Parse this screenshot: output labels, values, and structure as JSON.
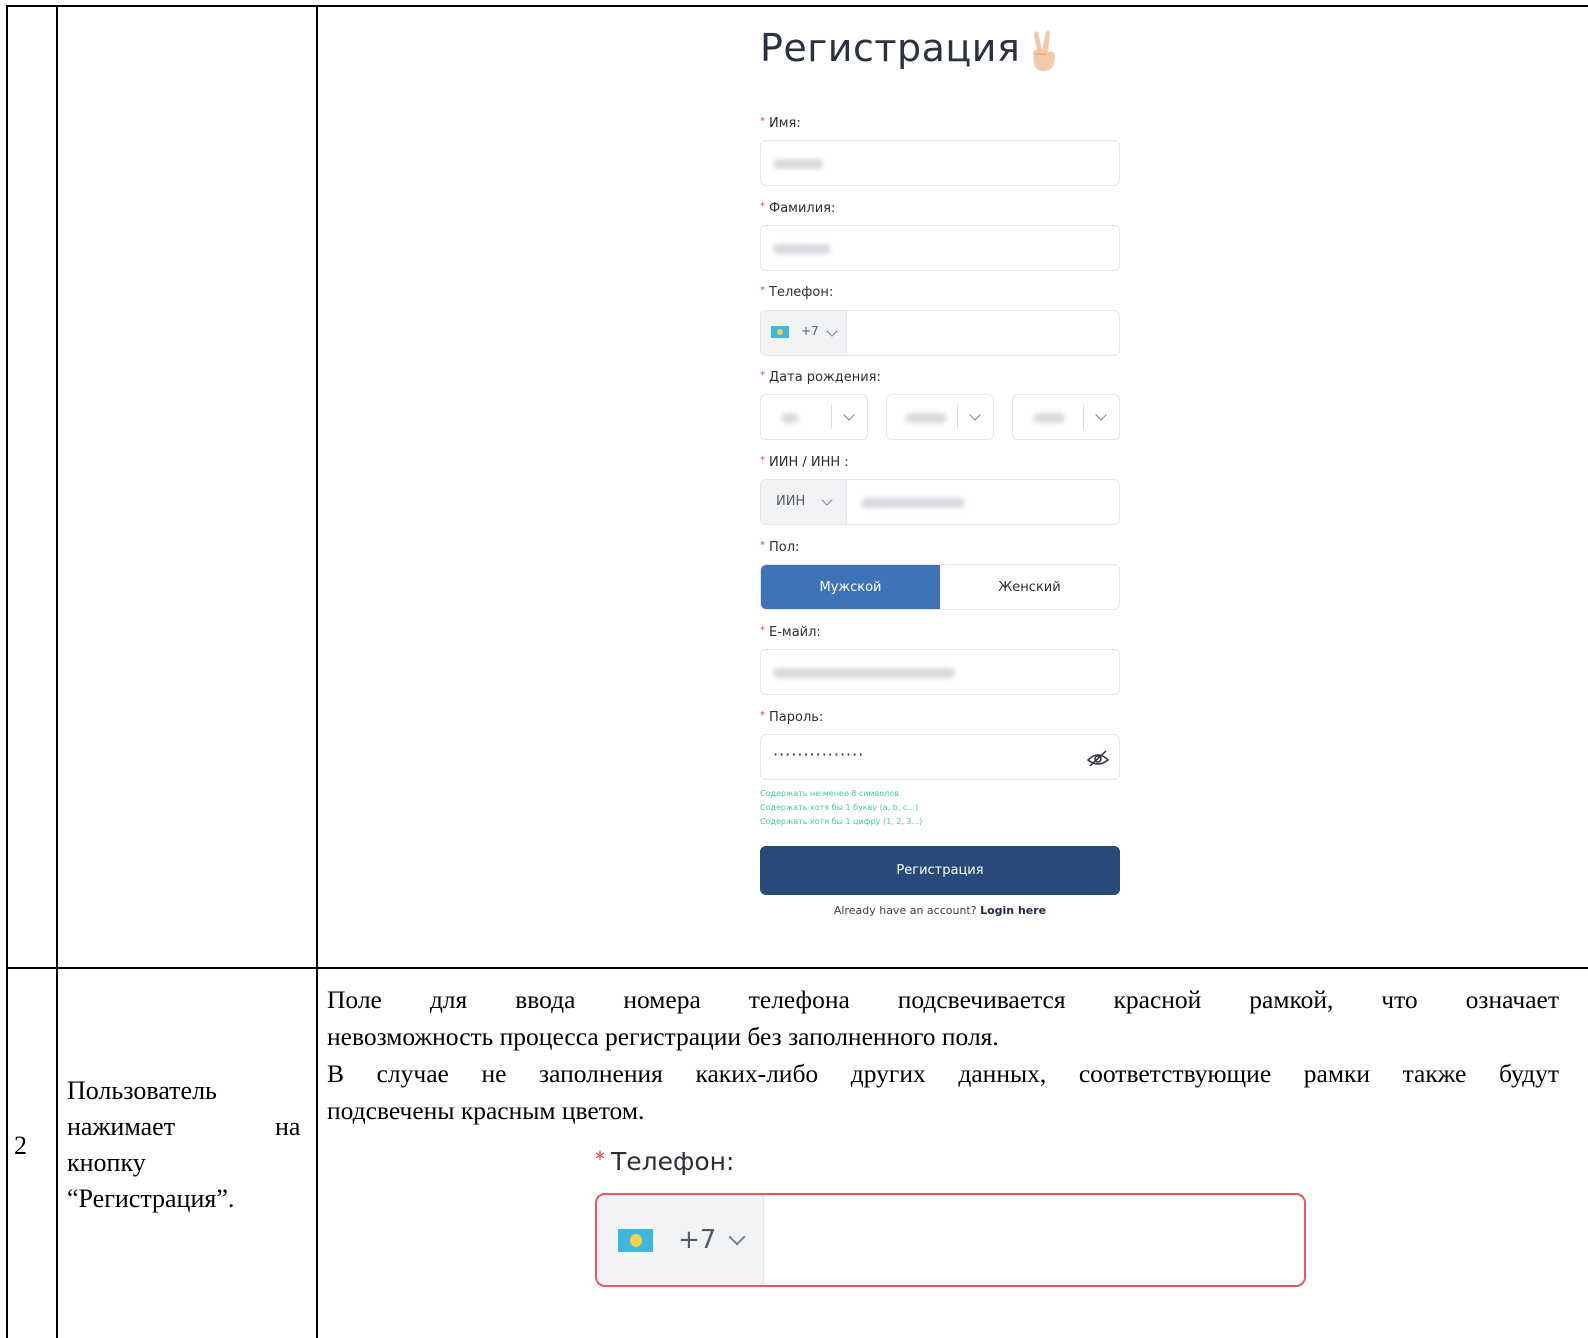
{
  "table": {
    "row1": {
      "form": {
        "title": "Регистрация",
        "labels": {
          "first_name": "Имя:",
          "last_name": "Фамилия:",
          "phone": "Телефон:",
          "birth_date": "Дата рождения:",
          "iin": "ИИН / ИНН :",
          "gender": "Пол:",
          "email": "Е-майл:",
          "password": "Пароль:"
        },
        "phone_code": "+7",
        "iin_type": "ИИН",
        "gender_options": [
          "Мужской",
          "Женский"
        ],
        "gender_selected": "Мужской",
        "password_mask": "···············",
        "password_hints": [
          "Содержать не менее 8 символов",
          "Содержать хотя бы 1 букву (a, b, c...)",
          "Содержать хотя бы 1 цифру (1, 2, 3...)"
        ],
        "submit_label": "Регистрация",
        "footer_text": "Already have an account?",
        "footer_link": "Login here"
      }
    },
    "row2": {
      "number": "2",
      "action": "Пользователь нажимает на кнопку “Регистрация”.",
      "action_lines": [
        "Пользователь",
        "нажимает",
        "на",
        "кнопку",
        "“Регистрация”."
      ],
      "result_lines": [
        "Поле для ввода номера телефона подсвечивается красной рамкой, что означает",
        "невозможность процесса регистрации без заполненного поля.",
        "В случае не заполнения каких-либо других данных, соответствующие рамки также будут",
        "подсвечены красным цветом."
      ],
      "zoom_label": "Телефон:",
      "zoom_code": "+7"
    }
  },
  "colors": {
    "primary_button": "#284a78",
    "selected_segment": "#3f73b8",
    "error_border": "#e85a63",
    "required_star": "#e0464b",
    "hint_text": "#46c9a4"
  },
  "icons": [
    "peace-hand-icon",
    "kazakhstan-flag-icon",
    "chevron-down-icon",
    "eye-hidden-icon"
  ]
}
